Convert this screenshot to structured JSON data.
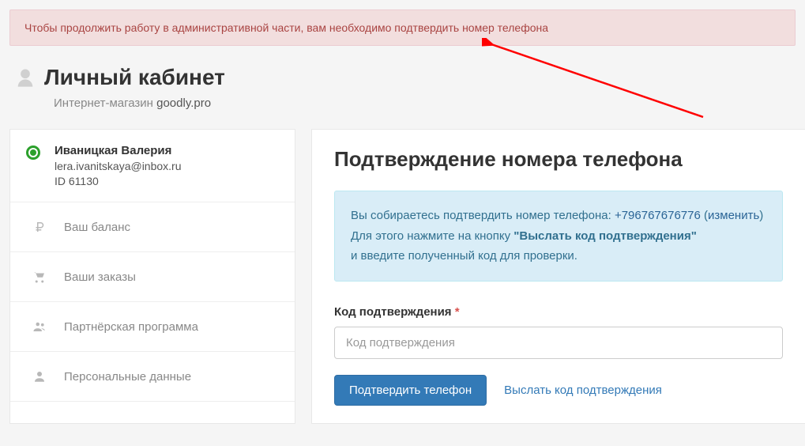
{
  "alert": {
    "message": "Чтобы продолжить работу в административной части, вам необходимо подтвердить номер телефона"
  },
  "header": {
    "title": "Личный кабинет",
    "subtitle_prefix": "Интернет-магазин ",
    "subtitle_domain": "goodly.pro"
  },
  "sidebar": {
    "user": {
      "name": "Иваницкая Валерия",
      "email": "lera.ivanitskaya@inbox.ru",
      "id_label": "ID 61130"
    },
    "items": [
      {
        "label": "Ваш баланс",
        "icon": "ruble-icon"
      },
      {
        "label": "Ваши заказы",
        "icon": "cart-icon"
      },
      {
        "label": "Партнёрская программа",
        "icon": "users-icon"
      },
      {
        "label": "Персональные данные",
        "icon": "user-icon"
      }
    ]
  },
  "main": {
    "title": "Подтверждение номера телефона",
    "info": {
      "line1_prefix": "Вы собираетесь подтвердить номер телефона: ",
      "phone": "+796767676776",
      "change_open": " (",
      "change_label": "изменить",
      "change_close": ")",
      "line2_prefix": "Для этого нажмите на кнопку ",
      "line2_bold": "\"Выслать код подтверждения\"",
      "line3": "и введите полученный код для проверки."
    },
    "form": {
      "label": "Код подтверждения",
      "required_mark": "*",
      "placeholder": "Код подтверждения",
      "submit_label": "Подтвердить телефон",
      "resend_label": "Выслать код подтверждения"
    }
  },
  "colors": {
    "alert_bg": "#f2dede",
    "alert_text": "#a94442",
    "info_bg": "#d9edf7",
    "info_text": "#31708f",
    "primary": "#337ab7",
    "arrow": "#ff0000"
  }
}
